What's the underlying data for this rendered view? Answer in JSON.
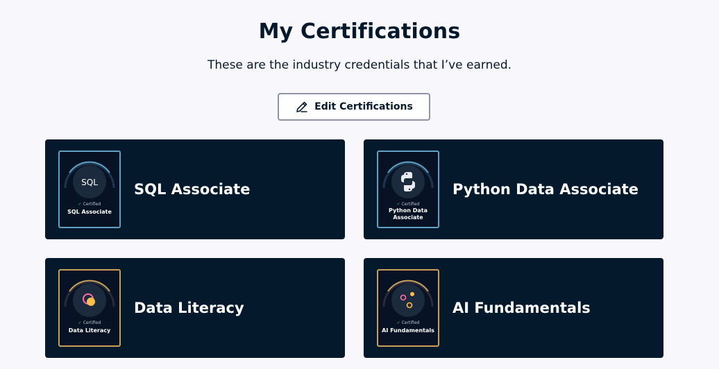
{
  "page": {
    "title": "My Certifications",
    "subtitle": "These are the industry credentials that I’ve earned."
  },
  "toolbar": {
    "edit_label": "Edit Certifications",
    "edit_icon": "pencil-icon"
  },
  "colors": {
    "background": "#f7f7fc",
    "card_background": "#05192d",
    "text_dark": "#05192d",
    "badge_border_blue": "#5ea1c4",
    "badge_border_gold": "#c7a15a",
    "certified_check": "#03ef62"
  },
  "certifications": [
    {
      "title": "SQL Associate",
      "badge_certified": "Certified",
      "badge_name": "SQL Associate",
      "badge_icon_text": "SQL",
      "badge_style": "blue"
    },
    {
      "title": "Python Data Associate",
      "badge_certified": "Certified",
      "badge_name": "Python Data Associate",
      "badge_icon": "python-logo-icon",
      "badge_style": "blue"
    },
    {
      "title": "Data Literacy",
      "badge_certified": "Certified",
      "badge_name": "Data Literacy",
      "badge_icon": "data-literacy-circles-icon",
      "badge_style": "gold"
    },
    {
      "title": "AI Fundamentals",
      "badge_certified": "Certified",
      "badge_name": "AI Fundamentals",
      "badge_icon": "ai-dots-icon",
      "badge_style": "gold"
    }
  ]
}
